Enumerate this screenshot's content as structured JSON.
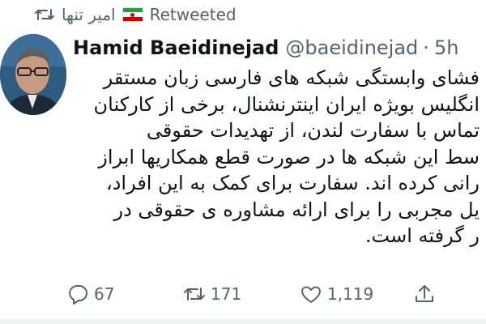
{
  "retweet_header": {
    "retweeter_name": "امیر تنها",
    "label": "Retweeted",
    "icon": "retweet-icon",
    "flag_icon": "iran-flag-icon"
  },
  "tweet": {
    "author": {
      "display_name": "Hamid Baeidinejad",
      "handle": "@baeidinejad",
      "separator": "·",
      "time": "5h",
      "avatar_icon": "avatar-photo"
    },
    "text_lines": [
      "فشای وابستگی شبکه های فارسی زبان مستقر",
      "انگلیس بویژه ایران اینترنشنال، برخی از کارکنان",
      "تماس با سفارت لندن، از تهدیدات حقوقی",
      "سط این شبکه ها در صورت قطع همکاریها ابراز",
      "رانی کرده اند. سفارت برای کمک به این افراد،",
      "یل مجربی را برای ارائه مشاوره ی حقوقی در",
      "ر گرفته است."
    ],
    "actions": {
      "reply": {
        "icon": "reply-icon",
        "count": "67"
      },
      "retweet": {
        "icon": "retweet-icon",
        "count": "171",
        "color": "#536471"
      },
      "like": {
        "icon": "heart-icon",
        "count": "1,119"
      },
      "share": {
        "icon": "share-icon"
      }
    }
  },
  "colors": {
    "text_primary": "#0f1419",
    "text_secondary": "#536471",
    "background": "#ffffff"
  }
}
